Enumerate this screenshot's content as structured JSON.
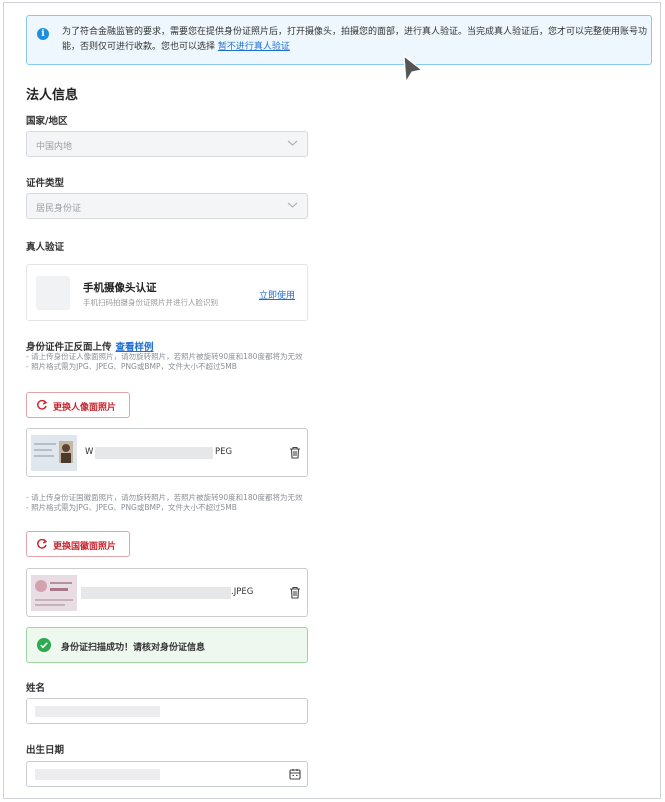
{
  "notice": {
    "text": "为了符合金融监管的要求，需要您在提供身份证照片后，打开摄像头，拍摄您的面部，进行真人验证。当完成真人验证后，您才可以完整使用账号功能，否则仅可进行收款。您也可以选择",
    "link": "暂不进行真人验证",
    "color": "#1f8fe0"
  },
  "section_title": "法人信息",
  "country": {
    "label": "国家/地区",
    "value": "中国内地"
  },
  "id_type": {
    "label": "证件类型",
    "value": "居民身份证"
  },
  "real_person": {
    "label": "真人验证",
    "card_title": "手机摄像头认证",
    "card_sub": "手机扫码拍摄身份证照片并进行人脸识别",
    "card_link": "立即使用"
  },
  "upload": {
    "title": "身份证件正反面上传",
    "example_link": "查看样例",
    "front_hints": [
      "- 请上传身份证人像面照片，请勿旋转照片，若照片被旋转90度和180度都将为无效",
      "- 照片格式需为JPG、JPEG、PNG或BMP，文件大小不超过5MB"
    ],
    "front_button": "更换人像面照片",
    "front_file_prefix": "W",
    "front_file_suffix": "PEG",
    "back_hints": [
      "- 请上传身份证国徽面照片，请勿旋转照片，若照片被旋转90度和180度都将为无效",
      "- 照片格式需为JPG、JPEG、PNG或BMP，文件大小不超过5MB"
    ],
    "back_button": "更换国徽面照片",
    "back_file_suffix": ".JPEG"
  },
  "success_message": "身份证扫描成功！请核对身份证信息",
  "name_label": "姓名",
  "birth_label": "出生日期",
  "colors": {
    "accent": "#1f6fd0",
    "danger": "#c8242e",
    "success": "#2eaa4f"
  }
}
